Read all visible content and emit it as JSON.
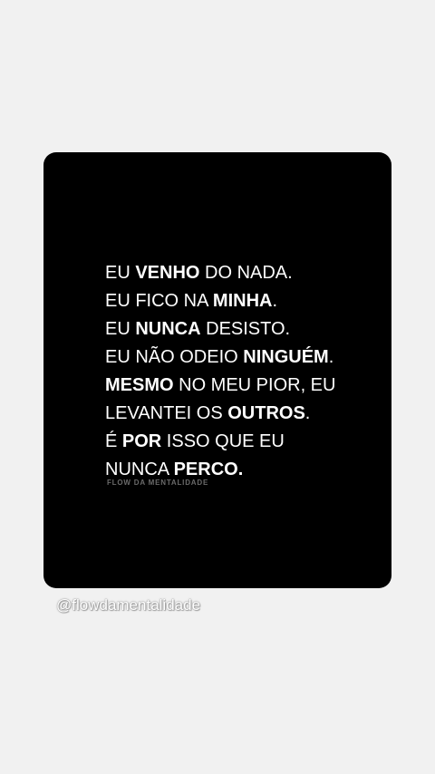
{
  "quote": {
    "lines": [
      [
        {
          "t": "EU ",
          "b": false
        },
        {
          "t": "VENHO",
          "b": true
        },
        {
          "t": " DO NADA.",
          "b": false
        }
      ],
      [
        {
          "t": "EU FICO NA ",
          "b": false
        },
        {
          "t": "MINHA",
          "b": true
        },
        {
          "t": ".",
          "b": false
        }
      ],
      [
        {
          "t": "EU ",
          "b": false
        },
        {
          "t": "NUNCA",
          "b": true
        },
        {
          "t": " DESISTO.",
          "b": false
        }
      ],
      [
        {
          "t": "EU NÃO ODEIO ",
          "b": false
        },
        {
          "t": "NINGUÉM",
          "b": true
        },
        {
          "t": ".",
          "b": false
        }
      ],
      [
        {
          "t": "MESMO",
          "b": true
        },
        {
          "t": " NO MEU PIOR, EU",
          "b": false
        }
      ],
      [
        {
          "t": "LEVANTEI OS ",
          "b": false
        },
        {
          "t": "OUTROS",
          "b": true
        },
        {
          "t": ".",
          "b": false
        }
      ],
      [
        {
          "t": "É ",
          "b": false
        },
        {
          "t": "POR",
          "b": true
        },
        {
          "t": " ISSO QUE EU",
          "b": false
        }
      ],
      [
        {
          "t": "NUNCA ",
          "b": false
        },
        {
          "t": "PERCO.",
          "b": true
        }
      ]
    ]
  },
  "brand": "FLOW DA MENTALIDADE",
  "handle": "@flowdamentalidade",
  "colors": {
    "background": "#f1f1f1",
    "card": "#000000",
    "text": "#ffffff",
    "brand": "#6a6a6a"
  }
}
